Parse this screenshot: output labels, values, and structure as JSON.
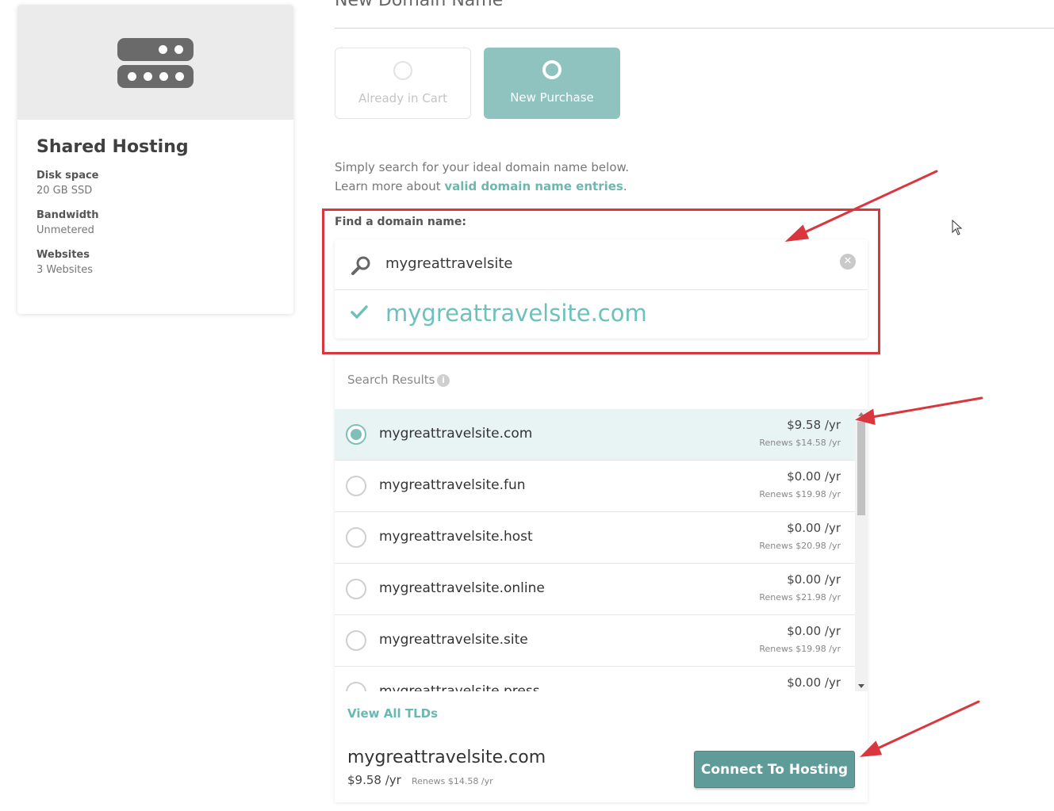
{
  "plan": {
    "title": "Shared Hosting",
    "specs": [
      {
        "label": "Disk space",
        "value": "20 GB SSD"
      },
      {
        "label": "Bandwidth",
        "value": "Unmetered"
      },
      {
        "label": "Websites",
        "value": "3 Websites"
      }
    ],
    "icon": "server-icon"
  },
  "header": {
    "title": "New Domain Name"
  },
  "options": {
    "already_in_cart": "Already in Cart",
    "new_purchase": "New Purchase",
    "selected": "New Purchase"
  },
  "intro": {
    "line1": "Simply search for your ideal domain name below.",
    "line2_prefix": "Learn more about ",
    "line2_link": "valid domain name entries",
    "line2_suffix": "."
  },
  "search": {
    "label": "Find a domain name:",
    "value": "mygreattravelsite",
    "suggestion": "mygreattravelsite.com"
  },
  "results": {
    "title": "Search Results",
    "items": [
      {
        "domain": "mygreattravelsite.com",
        "price": "$9.58 /yr",
        "renews": "Renews $14.58 /yr",
        "selected": true
      },
      {
        "domain": "mygreattravelsite.fun",
        "price": "$0.00 /yr",
        "renews": "Renews $19.98 /yr",
        "selected": false
      },
      {
        "domain": "mygreattravelsite.host",
        "price": "$0.00 /yr",
        "renews": "Renews $20.98 /yr",
        "selected": false
      },
      {
        "domain": "mygreattravelsite.online",
        "price": "$0.00 /yr",
        "renews": "Renews $21.98 /yr",
        "selected": false
      },
      {
        "domain": "mygreattravelsite.site",
        "price": "$0.00 /yr",
        "renews": "Renews $19.98 /yr",
        "selected": false
      },
      {
        "domain": "mygreattravelsite.press",
        "price": "$0.00 /yr",
        "renews": "",
        "selected": false
      }
    ],
    "view_all": "View All TLDs"
  },
  "summary": {
    "domain": "mygreattravelsite.com",
    "price": "$9.58 /yr",
    "renews": "Renews $14.58 /yr",
    "button": "Connect To Hosting"
  },
  "colors": {
    "accent": "#6ec1bb",
    "tile_selected": "#8ec3c0",
    "button": "#5f9c99",
    "annotation": "#d9363e"
  }
}
